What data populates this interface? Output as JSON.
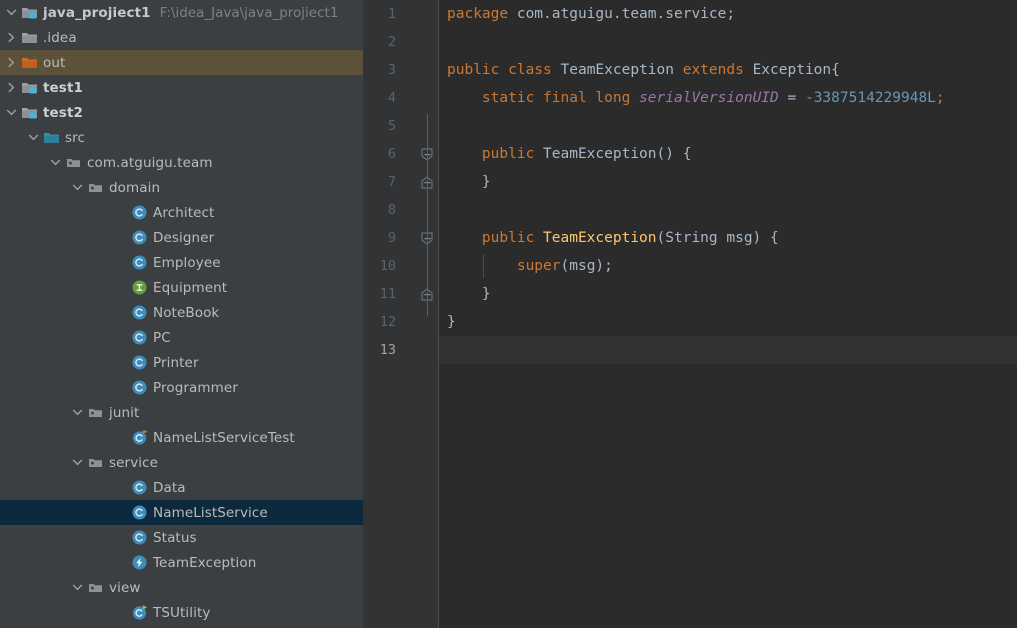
{
  "project_panel": {
    "header": {
      "name": "java_projiect1",
      "path": "F:\\idea_Java\\java_projiect1",
      "icon": "module-folder-icon"
    },
    "rows": [
      {
        "label": ".idea",
        "indent": 1,
        "twisty": "right",
        "icon": "folder-icon",
        "style": "plain",
        "state": "normal"
      },
      {
        "label": "out",
        "indent": 1,
        "twisty": "right",
        "icon": "folder-excluded-icon",
        "style": "plain",
        "state": "hovered"
      },
      {
        "label": "test1",
        "indent": 1,
        "twisty": "right",
        "icon": "module-folder-icon",
        "style": "bold",
        "state": "normal"
      },
      {
        "label": "test2",
        "indent": 1,
        "twisty": "down",
        "icon": "module-folder-icon",
        "style": "bold",
        "state": "normal"
      },
      {
        "label": "src",
        "indent": 2,
        "twisty": "down",
        "icon": "source-folder-icon",
        "style": "plain",
        "state": "normal"
      },
      {
        "label": "com.atguigu.team",
        "indent": 3,
        "twisty": "down",
        "icon": "package-icon",
        "style": "plain",
        "state": "normal"
      },
      {
        "label": "domain",
        "indent": 4,
        "twisty": "down",
        "icon": "package-icon",
        "style": "plain",
        "state": "normal"
      },
      {
        "label": "Architect",
        "indent": 6,
        "twisty": "none",
        "icon": "class-icon",
        "style": "plain",
        "state": "normal"
      },
      {
        "label": "Designer",
        "indent": 6,
        "twisty": "none",
        "icon": "class-icon",
        "style": "plain",
        "state": "normal"
      },
      {
        "label": "Employee",
        "indent": 6,
        "twisty": "none",
        "icon": "class-icon",
        "style": "plain",
        "state": "normal"
      },
      {
        "label": "Equipment",
        "indent": 6,
        "twisty": "none",
        "icon": "interface-icon",
        "style": "plain",
        "state": "normal"
      },
      {
        "label": "NoteBook",
        "indent": 6,
        "twisty": "none",
        "icon": "class-icon",
        "style": "plain",
        "state": "normal"
      },
      {
        "label": "PC",
        "indent": 6,
        "twisty": "none",
        "icon": "class-icon",
        "style": "plain",
        "state": "normal"
      },
      {
        "label": "Printer",
        "indent": 6,
        "twisty": "none",
        "icon": "class-icon",
        "style": "plain",
        "state": "normal"
      },
      {
        "label": "Programmer",
        "indent": 6,
        "twisty": "none",
        "icon": "class-icon",
        "style": "plain",
        "state": "normal"
      },
      {
        "label": "junit",
        "indent": 4,
        "twisty": "down",
        "icon": "package-icon",
        "style": "plain",
        "state": "normal"
      },
      {
        "label": "NameListServiceTest",
        "indent": 6,
        "twisty": "none",
        "icon": "test-class-icon",
        "style": "plain",
        "state": "normal"
      },
      {
        "label": "service",
        "indent": 4,
        "twisty": "down",
        "icon": "package-icon",
        "style": "plain",
        "state": "normal"
      },
      {
        "label": "Data",
        "indent": 6,
        "twisty": "none",
        "icon": "class-icon",
        "style": "plain",
        "state": "normal"
      },
      {
        "label": "NameListService",
        "indent": 6,
        "twisty": "none",
        "icon": "class-icon",
        "style": "plain",
        "state": "selected"
      },
      {
        "label": "Status",
        "indent": 6,
        "twisty": "none",
        "icon": "class-icon",
        "style": "plain",
        "state": "normal"
      },
      {
        "label": "TeamException",
        "indent": 6,
        "twisty": "none",
        "icon": "exception-class-icon",
        "style": "plain",
        "state": "normal"
      },
      {
        "label": "view",
        "indent": 4,
        "twisty": "down",
        "icon": "package-icon",
        "style": "plain",
        "state": "normal"
      },
      {
        "label": "TSUtility",
        "indent": 6,
        "twisty": "none",
        "icon": "runnable-class-icon",
        "style": "plain",
        "state": "normal"
      }
    ]
  },
  "editor": {
    "current_line": 13,
    "line_numbers": [
      1,
      2,
      3,
      4,
      5,
      6,
      7,
      8,
      9,
      10,
      11,
      12,
      13
    ],
    "fold_markers": [
      {
        "line": 6,
        "kind": "fold-start-icon"
      },
      {
        "line": 7,
        "kind": "fold-end-icon"
      },
      {
        "line": 9,
        "kind": "fold-start-icon"
      },
      {
        "line": 11,
        "kind": "fold-end-icon"
      }
    ],
    "lines": [
      {
        "n": 1,
        "tokens": [
          {
            "t": "package ",
            "c": "kw"
          },
          {
            "t": "com.atguigu.team.service;",
            "c": "plain"
          }
        ]
      },
      {
        "n": 2,
        "tokens": []
      },
      {
        "n": 3,
        "tokens": [
          {
            "t": "public ",
            "c": "kw"
          },
          {
            "t": "class ",
            "c": "kw"
          },
          {
            "t": "TeamException ",
            "c": "cls"
          },
          {
            "t": "extends ",
            "c": "kw"
          },
          {
            "t": "Exception{",
            "c": "plain"
          }
        ]
      },
      {
        "n": 4,
        "tokens": [
          {
            "t": "    ",
            "c": "plain"
          },
          {
            "t": "static ",
            "c": "kw"
          },
          {
            "t": "final ",
            "c": "kw"
          },
          {
            "t": "long ",
            "c": "kw"
          },
          {
            "t": "serialVersionUID",
            "c": "field"
          },
          {
            "t": " = ",
            "c": "plain"
          },
          {
            "t": "-3387514229948L",
            "c": "num"
          },
          {
            "t": ";",
            "c": "kw"
          }
        ]
      },
      {
        "n": 5,
        "tokens": []
      },
      {
        "n": 6,
        "tokens": [
          {
            "t": "    ",
            "c": "plain"
          },
          {
            "t": "public ",
            "c": "kw"
          },
          {
            "t": "TeamException() {",
            "c": "cls"
          }
        ]
      },
      {
        "n": 7,
        "tokens": [
          {
            "t": "    }",
            "c": "plain"
          }
        ]
      },
      {
        "n": 8,
        "tokens": []
      },
      {
        "n": 9,
        "tokens": [
          {
            "t": "    ",
            "c": "plain"
          },
          {
            "t": "public ",
            "c": "kw"
          },
          {
            "t": "TeamException",
            "c": "ctor"
          },
          {
            "t": "(String msg) {",
            "c": "plain"
          }
        ]
      },
      {
        "n": 10,
        "tokens": [
          {
            "t": "        ",
            "c": "plain"
          },
          {
            "t": "super",
            "c": "kw"
          },
          {
            "t": "(msg);",
            "c": "plain"
          }
        ]
      },
      {
        "n": 11,
        "tokens": [
          {
            "t": "    }",
            "c": "plain"
          }
        ]
      },
      {
        "n": 12,
        "tokens": [
          {
            "t": "}",
            "c": "plain"
          }
        ]
      },
      {
        "n": 13,
        "tokens": []
      }
    ]
  },
  "colors": {
    "panel_bg": "#3c3f41",
    "editor_bg": "#2b2b2b",
    "gutter_bg": "#313335",
    "selection_bg": "#0d293e",
    "hover_bg": "#5c5139",
    "caret_line_bg": "#323232",
    "keyword": "#cc7832",
    "field": "#9876aa",
    "number": "#6897bb",
    "constructor": "#ffc66d",
    "text": "#a9b7c6",
    "class_icon": "#3b8dbd",
    "interface_icon": "#62a035",
    "excluded_folder": "#c1601d"
  }
}
